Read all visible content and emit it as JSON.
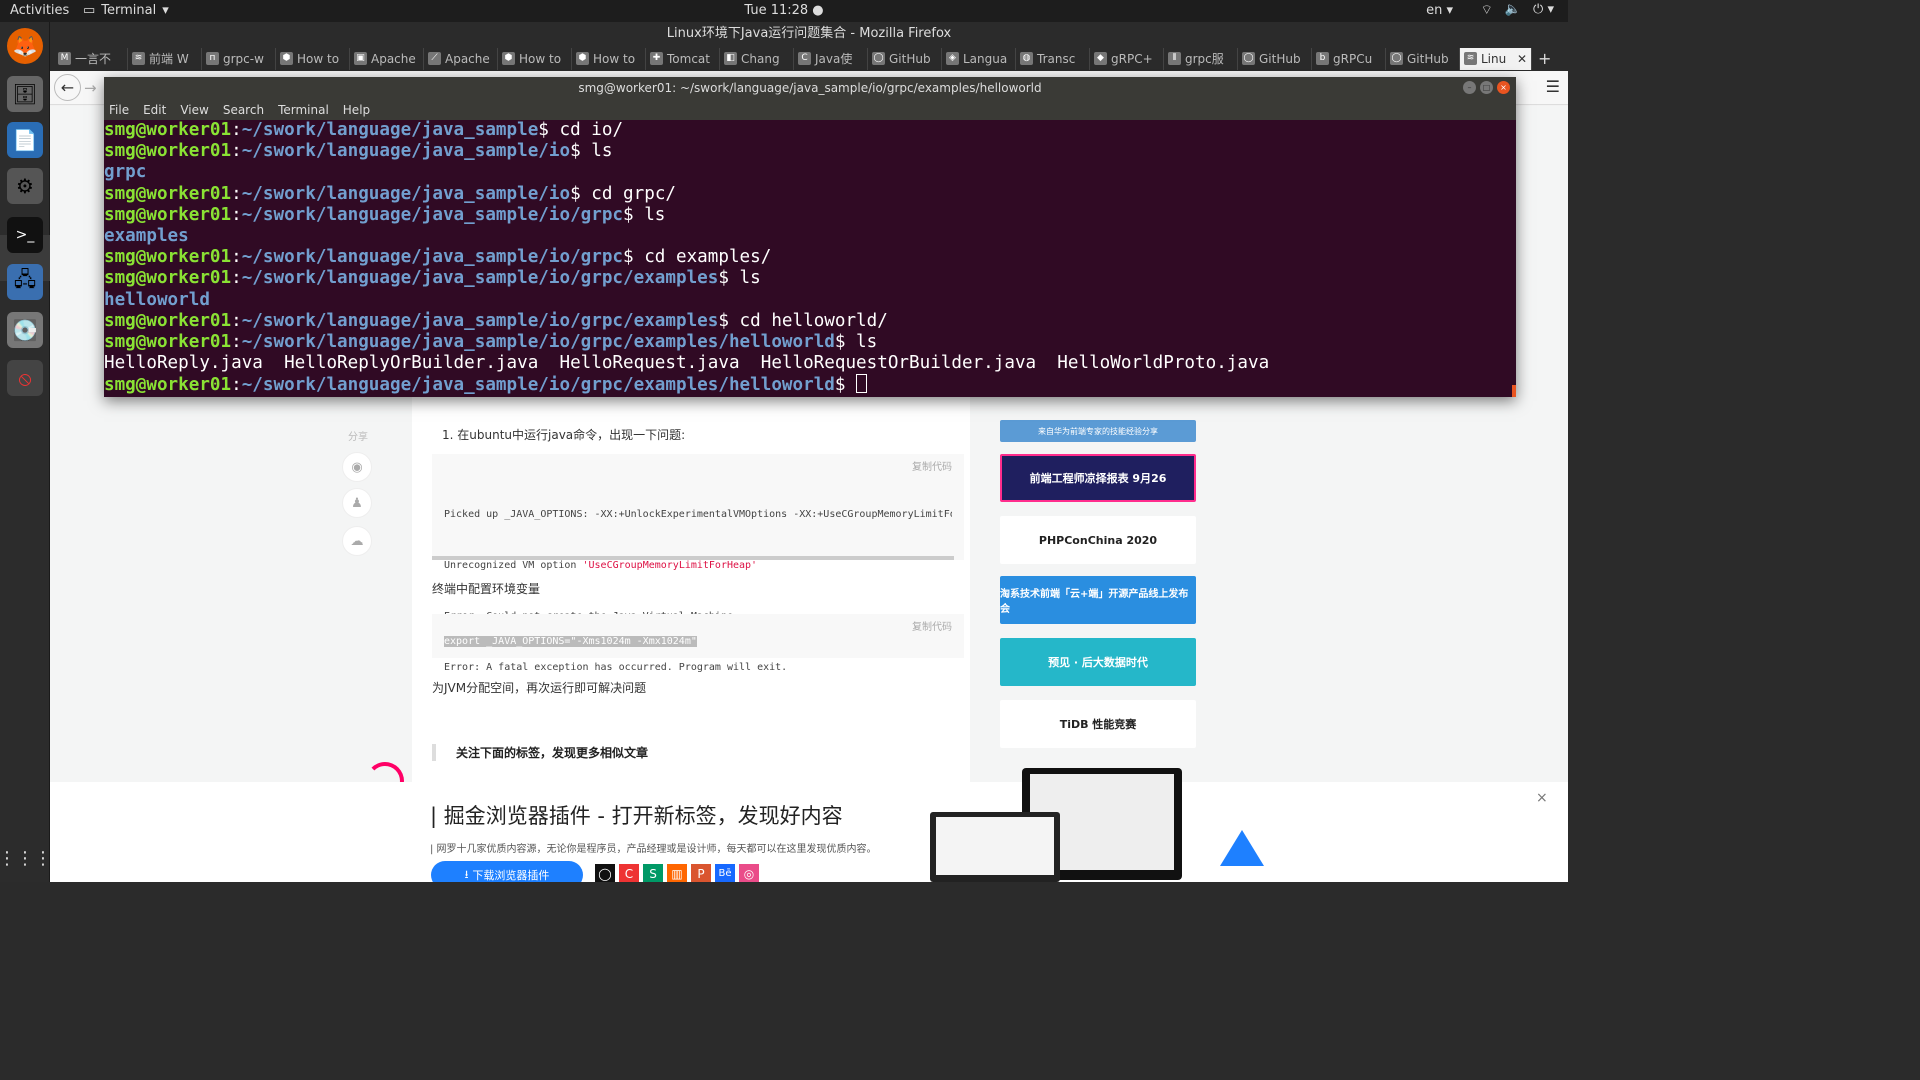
{
  "topbar": {
    "activities": "Activities",
    "app_name": "Terminal",
    "clock": "Tue 11:28 ●",
    "lang": "en"
  },
  "firefox": {
    "window_title": "Linux环境下Java运行问题集合 - Mozilla Firefox",
    "tabs": [
      {
        "label": "一言不",
        "icon": "M"
      },
      {
        "label": "前端 W",
        "icon": "≋"
      },
      {
        "label": "grpc-w",
        "icon": "п"
      },
      {
        "label": "How to",
        "icon": "⬢"
      },
      {
        "label": "Apache",
        "icon": "▣"
      },
      {
        "label": "Apache",
        "icon": "⟋"
      },
      {
        "label": "How to",
        "icon": "⬢"
      },
      {
        "label": "How to",
        "icon": "⬢"
      },
      {
        "label": "Tomcat",
        "icon": "✚"
      },
      {
        "label": "Chang",
        "icon": "◧"
      },
      {
        "label": "Java使",
        "icon": "C"
      },
      {
        "label": "GitHub",
        "icon": "◯"
      },
      {
        "label": "Langua",
        "icon": "◈"
      },
      {
        "label": "Transc",
        "icon": "◍"
      },
      {
        "label": "gRPC+",
        "icon": "◆"
      },
      {
        "label": "grpc服",
        "icon": "⫴"
      },
      {
        "label": "GitHub",
        "icon": "◯"
      },
      {
        "label": "gRPCu",
        "icon": "b"
      },
      {
        "label": "GitHub",
        "icon": "◯"
      },
      {
        "label": "Linu",
        "icon": "≋"
      }
    ]
  },
  "terminal": {
    "title": "smg@worker01: ~/swork/language/java_sample/io/grpc/examples/helloworld",
    "menu": [
      "File",
      "Edit",
      "View",
      "Search",
      "Terminal",
      "Help"
    ],
    "user": "smg@worker01",
    "lines": [
      {
        "type": "prompt",
        "path": "~/swork/language/java_sample",
        "cmd": " cd io/"
      },
      {
        "type": "prompt",
        "path": "~/swork/language/java_sample/io",
        "cmd": " ls"
      },
      {
        "type": "dir",
        "text": "grpc"
      },
      {
        "type": "prompt",
        "path": "~/swork/language/java_sample/io",
        "cmd": " cd grpc/"
      },
      {
        "type": "prompt",
        "path": "~/swork/language/java_sample/io/grpc",
        "cmd": " ls"
      },
      {
        "type": "dir",
        "text": "examples"
      },
      {
        "type": "prompt",
        "path": "~/swork/language/java_sample/io/grpc",
        "cmd": " cd examples/"
      },
      {
        "type": "prompt",
        "path": "~/swork/language/java_sample/io/grpc/examples",
        "cmd": " ls"
      },
      {
        "type": "dir",
        "text": "helloworld"
      },
      {
        "type": "prompt",
        "path": "~/swork/language/java_sample/io/grpc/examples",
        "cmd": " cd helloworld/"
      },
      {
        "type": "prompt",
        "path": "~/swork/language/java_sample/io/grpc/examples/helloworld",
        "cmd": " ls"
      },
      {
        "type": "out",
        "text": "HelloReply.java  HelloReplyOrBuilder.java  HelloRequest.java  HelloRequestOrBuilder.java  HelloWorldProto.java"
      },
      {
        "type": "prompt",
        "path": "~/swork/language/java_sample/io/grpc/examples/helloworld",
        "cmd": " ",
        "cursor": true
      }
    ]
  },
  "article": {
    "share_label": "分享",
    "step1": "1.  在ubuntu中运行java命令，出现一下问题:",
    "copy_label": "复制代码",
    "code1": [
      "Picked up _JAVA_OPTIONS: -XX:+UnlockExperimentalVMOptions -XX:+UseCGroupMemoryLimitForHea",
      "Unrecognized VM option 'UseCGroupMemoryLimitForHeap'",
      "Error: Could not create the Java Virtual Machine.",
      "Error: A fatal exception has occurred. Program will exit."
    ],
    "para2": "终端中配置环境变量",
    "code2": "export _JAVA_OPTIONS=\"-Xms1024m -Xmx1024m\"",
    "para3": "为JVM分配空间，再次运行即可解决问题",
    "tags_heading": "关注下面的标签，发现更多相似文章"
  },
  "ads": [
    {
      "text": "来自华为前端专家的技能经验分享",
      "color": "#5b9bd5"
    },
    {
      "text": "前端工程师凉择报表  9月26",
      "color": "#1f1f5f"
    },
    {
      "text": "PHPConChina 2020",
      "color": "#ffffff"
    },
    {
      "text": "淘系技术前端「云+端」开源产品线上发布会",
      "color": "#2a8ee0"
    },
    {
      "text": "预见 · 后大数据时代",
      "color": "#25b7c9"
    },
    {
      "text": "TiDB 性能竞赛",
      "color": "#ffffff"
    }
  ],
  "banner": {
    "title": "| 掘金浏览器插件 - 打开新标签，发现好内容",
    "subtitle": "| 网罗十几家优质内容源，无论你是程序员，产品经理或是设计师，每天都可以在这里发现优质内容。",
    "download_label": "下载浏览器插件",
    "close": "×"
  }
}
